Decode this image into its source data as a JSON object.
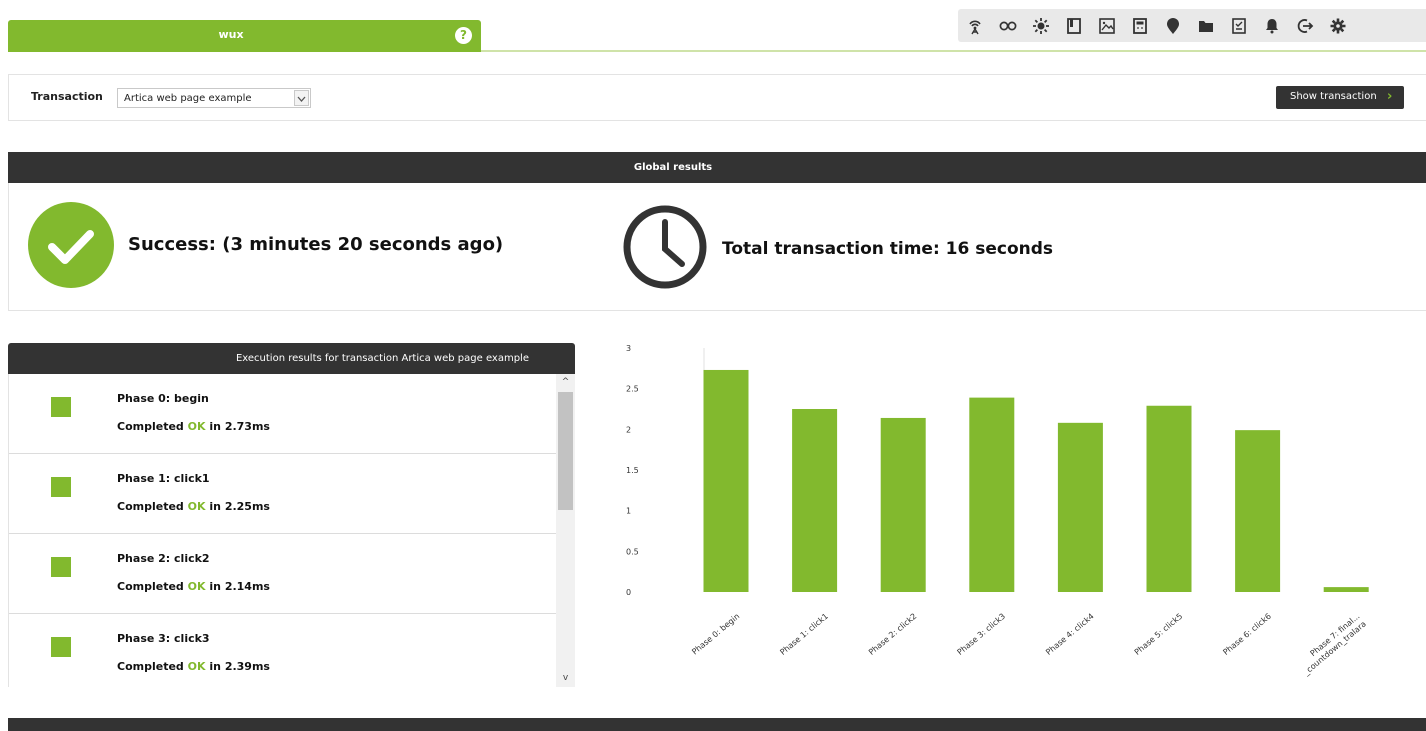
{
  "tab": {
    "title": "wux",
    "help": "?"
  },
  "toolbar": {
    "icons": [
      "wifi-tower-icon",
      "infinity-icon",
      "sun-icon",
      "book-icon",
      "image-icon",
      "calculator-icon",
      "map-pin-icon",
      "folder-icon",
      "notepad-icon",
      "bell-icon",
      "logout-icon",
      "gear-icon"
    ]
  },
  "filter": {
    "label": "Transaction",
    "selected": "Artica web page example",
    "show_button": "Show transaction",
    "show_arrow": "›"
  },
  "global": {
    "header": "Global results",
    "success": "Success: (3 minutes 20 seconds ago)",
    "total": "Total transaction time: 16 seconds"
  },
  "execution": {
    "header": "Execution results for transaction Artica web page example",
    "completed_prefix": "Completed",
    "ok": "OK",
    "in": "in",
    "phases": [
      {
        "title": "Phase 0: begin",
        "time": "2.73ms"
      },
      {
        "title": "Phase 1: click1",
        "time": "2.25ms"
      },
      {
        "title": "Phase 2: click2",
        "time": "2.14ms"
      },
      {
        "title": "Phase 3: click3",
        "time": "2.39ms"
      }
    ],
    "scroll_up": "^",
    "scroll_down": "v"
  },
  "colors": {
    "accent": "#82b92e",
    "dark": "#333333"
  },
  "chart_data": {
    "type": "bar",
    "categories": [
      "Phase 0: begin",
      "Phase 1: click1",
      "Phase 2: click2",
      "Phase 3: click3",
      "Phase 4: click4",
      "Phase 5: click5",
      "Phase 6: click6",
      "Phase 7: final..._countdown_tralara"
    ],
    "category_lines": [
      [
        "Phase 0: begin"
      ],
      [
        "Phase 1: click1"
      ],
      [
        "Phase 2: click2"
      ],
      [
        "Phase 3: click3"
      ],
      [
        "Phase 4: click4"
      ],
      [
        "Phase 5: click5"
      ],
      [
        "Phase 6: click6"
      ],
      [
        "Phase 7: final...",
        "_countdown_tralara"
      ]
    ],
    "values": [
      2.73,
      2.25,
      2.14,
      2.39,
      2.08,
      2.29,
      1.99,
      0.06
    ],
    "ylim": [
      0,
      3
    ],
    "yticks": [
      "0",
      "0.5",
      "1",
      "1.5",
      "2",
      "2.5",
      "3"
    ],
    "color": "#82b92e",
    "grid": false
  }
}
